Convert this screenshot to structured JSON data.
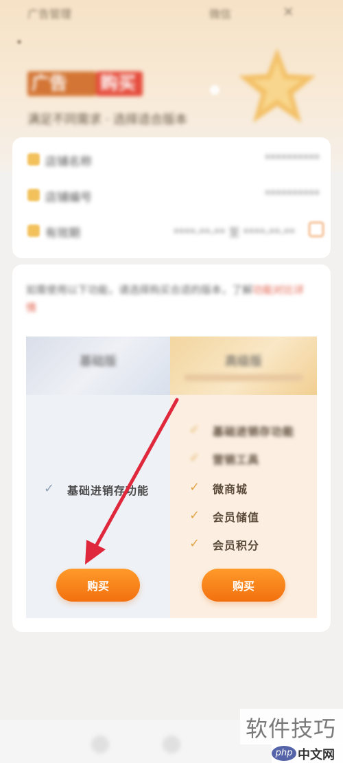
{
  "topbar": {
    "left_text": "广告管理",
    "right_text": "微信",
    "close_icon": "close-icon"
  },
  "brand": {
    "title_part1": "广告",
    "title_part2": "购买",
    "subtitle": "满足不同需求 · 选择适合版本"
  },
  "info_rows": [
    {
      "label": "店铺名称",
      "value": "**********"
    },
    {
      "label": "店铺编号",
      "value": "**********"
    },
    {
      "label": "有效期",
      "value": "****-**-** 至 ****-**-**"
    }
  ],
  "notice": {
    "text": "如需使用以下功能，请选择购买合适的版本，了解",
    "link": "功能对比详情"
  },
  "plans": {
    "basic": {
      "title": "基础版",
      "features": [
        {
          "label": "基础进销存功能"
        }
      ],
      "buy_label": "购买"
    },
    "advanced": {
      "title": "高级版",
      "features": [
        {
          "label": "基础进销存功能",
          "blurred": true
        },
        {
          "label": "营销工具",
          "blurred": true
        },
        {
          "label": "微商城"
        },
        {
          "label": "会员储值"
        },
        {
          "label": "会员积分"
        }
      ],
      "buy_label": "购买"
    }
  },
  "watermark": {
    "site_name": "软件技巧",
    "logo": "php",
    "logo_suffix": "中文网"
  },
  "colors": {
    "accent": "#f2700f",
    "check": "#e1a54a",
    "arrow": "#e0283c"
  }
}
